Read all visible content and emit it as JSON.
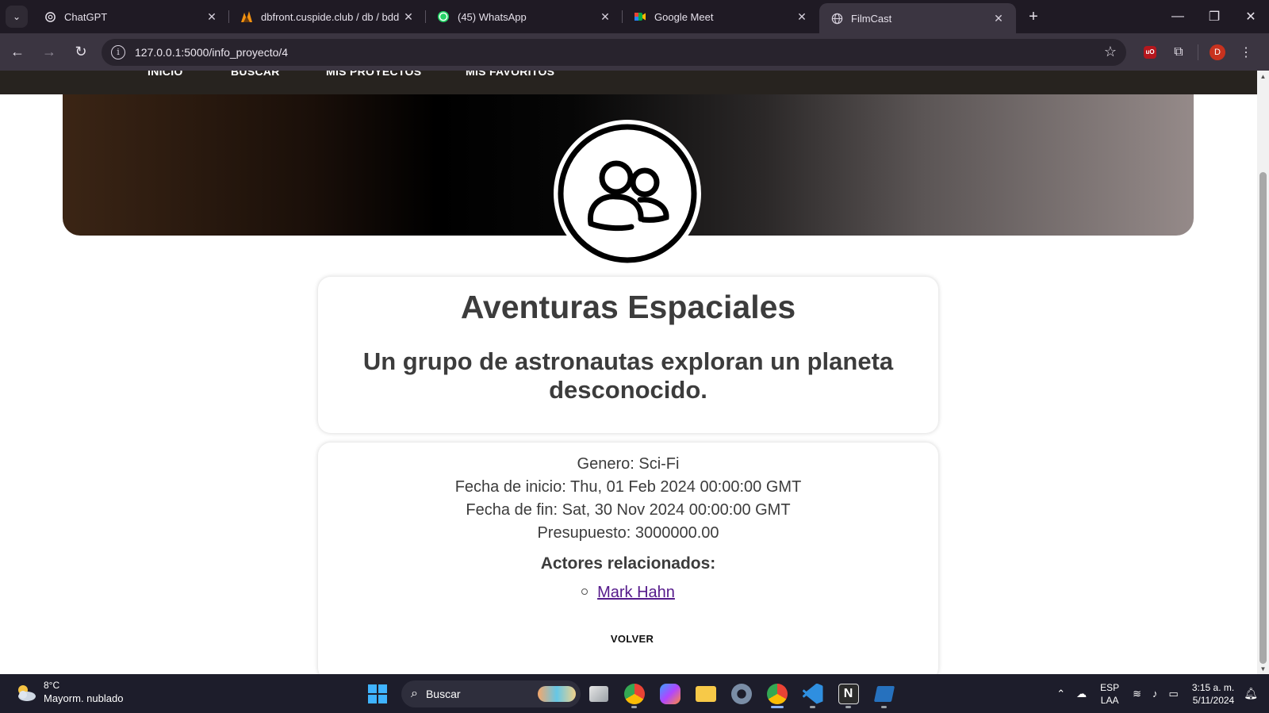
{
  "browser": {
    "tabs": [
      {
        "title": "ChatGPT",
        "icon": "openai-icon",
        "active": false
      },
      {
        "title": "dbfront.cuspide.club / db / bdd",
        "icon": "database-icon",
        "active": false
      },
      {
        "title": "(45) WhatsApp",
        "icon": "whatsapp-icon",
        "active": false
      },
      {
        "title": "Google Meet",
        "icon": "google-meet-icon",
        "active": false
      },
      {
        "title": "FilmCast",
        "icon": "globe-icon",
        "active": true
      }
    ],
    "url": "127.0.0.1:5000/info_proyecto/4",
    "profile_initial": "D",
    "ublock_label": "uO"
  },
  "site": {
    "nav": [
      {
        "label": "INICIO"
      },
      {
        "label": "BUSCAR"
      },
      {
        "label": "MIS PROYECTOS"
      },
      {
        "label": "MIS FAVORITOS"
      }
    ]
  },
  "project": {
    "title": "Aventuras Espaciales",
    "description": "Un grupo de astronautas exploran un planeta desconocido.",
    "genre": "Genero: Sci-Fi",
    "start_date": "Fecha de inicio: Thu, 01 Feb 2024 00:00:00 GMT",
    "end_date": "Fecha de fin: Sat, 30 Nov 2024 00:00:00 GMT",
    "budget": "Presupuesto: 3000000.00",
    "actors_heading": "Actores relacionados:",
    "actors": [
      "Mark Hahn"
    ],
    "back_label": "VOLVER"
  },
  "taskbar": {
    "weather_temp": "8°C",
    "weather_desc": "Mayorm. nublado",
    "search_placeholder": "Buscar",
    "lang_line1": "ESP",
    "lang_line2": "LAA",
    "time": "3:15 a. m.",
    "date": "5/11/2024",
    "chrome_badge": "D"
  },
  "colors": {
    "accent_link": "#551a8b",
    "site_nav_bg": "#27231f",
    "browser_frame": "#1f1a24"
  }
}
